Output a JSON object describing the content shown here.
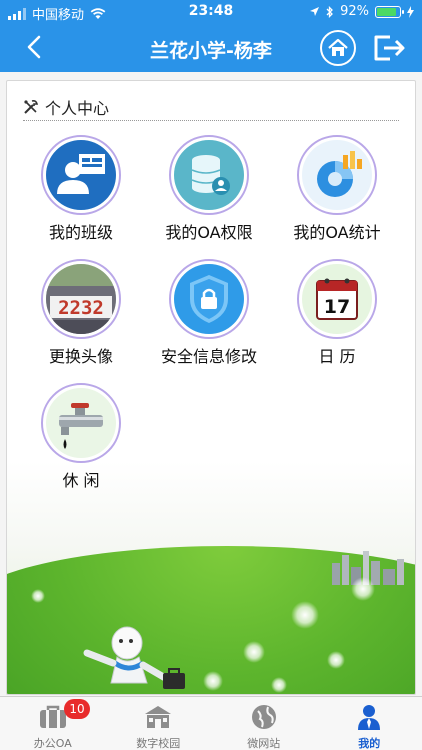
{
  "status_bar": {
    "carrier": "中国移动",
    "time": "23:48",
    "battery_percent": "92%",
    "battery_level": 0.92
  },
  "nav": {
    "title": "兰花小学-杨李",
    "back_icon": "chevron-left-icon",
    "home_icon": "home-icon",
    "logout_icon": "logout-icon"
  },
  "section": {
    "title": "个人中心",
    "icon": "tools-icon"
  },
  "items": [
    {
      "label": "我的班级",
      "icon": "class-icon"
    },
    {
      "label": "我的OA权限",
      "icon": "database-user-icon"
    },
    {
      "label": "我的OA统计",
      "icon": "pie-chart-icon"
    },
    {
      "label": "更换头像",
      "icon": "avatar-photo-icon",
      "photo_text": "2232"
    },
    {
      "label": "安全信息修改",
      "icon": "shield-lock-icon"
    },
    {
      "label": "日 历",
      "icon": "calendar-icon",
      "calendar_day": "17"
    },
    {
      "label": "休 闲",
      "icon": "faucet-icon"
    }
  ],
  "tabs": [
    {
      "label": "办公OA",
      "icon": "briefcase-icon",
      "badge": "10"
    },
    {
      "label": "数字校园",
      "icon": "school-icon"
    },
    {
      "label": "微网站",
      "icon": "globe-icon"
    },
    {
      "label": "我的",
      "icon": "person-icon",
      "active": true
    }
  ],
  "colors": {
    "header": "#2a93e8",
    "active_tab": "#1a5fd0",
    "badge": "#e82b2b",
    "ring": "#b9a7e8"
  }
}
